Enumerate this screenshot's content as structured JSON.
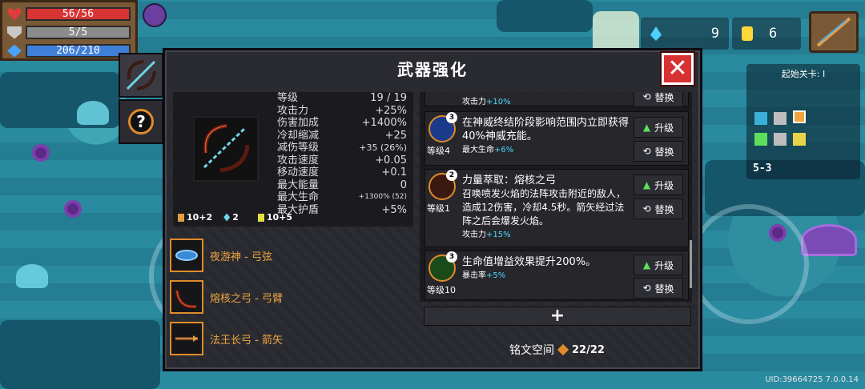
{
  "hud": {
    "hp": "56/56",
    "armor": "5/5",
    "energy": "206/210",
    "blue_currency": "9",
    "gold_currency": "6"
  },
  "minimap": {
    "title": "起始关卡: I",
    "level": "5-3"
  },
  "uid": "UID:39664725 7.0.0.14",
  "dialog": {
    "title": "武器强化",
    "close_label": "✕"
  },
  "weapon_stats": [
    {
      "label": "等级",
      "value": "19 / 19"
    },
    {
      "label": "攻击力",
      "value": "+25%"
    },
    {
      "label": "伤害加成",
      "value": "+1400%"
    },
    {
      "label": "冷却缩减",
      "value": "+25"
    },
    {
      "label": "减伤等级",
      "value": "+35 (26%)"
    },
    {
      "label": "攻击速度",
      "value": "+0.05"
    },
    {
      "label": "移动速度",
      "value": "+0.1"
    },
    {
      "label": "最大能量",
      "value": "0"
    },
    {
      "label": "最大生命",
      "value": "+1300% (52)"
    },
    {
      "label": "最大护盾",
      "value": "+5%"
    }
  ],
  "weapon_footer": {
    "atk": "10+2",
    "crystal": "2",
    "crit": "10+5"
  },
  "parts": [
    {
      "name": "夜游神 - 弓弦"
    },
    {
      "name": "熔核之弓 - 弓臂"
    },
    {
      "name": "法王长弓 - 箭矢"
    }
  ],
  "inscriptions": {
    "partial_top": {
      "sub_prefix": "攻击力",
      "sub_value": "+10%",
      "swap": "替换"
    },
    "items": [
      {
        "desc": "在神威终结阶段影响范围内立即获得40%神威充能。",
        "sub_prefix": "最大生命",
        "sub_value": "+6%",
        "level": "等级4",
        "badge": "3",
        "upgrade": "升级",
        "swap": "替换"
      },
      {
        "desc": "力量萃取：熔核之弓",
        "desc2": "召唤喷发火焰的法阵攻击附近的敌人，造成12伤害，冷却4.5秒。箭矢经过法阵之后会爆发火焰。",
        "sub_prefix": "攻击力",
        "sub_value": "+15%",
        "level": "等级1",
        "badge": "2",
        "upgrade": "升级",
        "swap": "替换"
      },
      {
        "desc": "生命值增益效果提升200%。",
        "sub_prefix": "暴击率",
        "sub_value": "+5%",
        "level": "等级10",
        "badge": "3",
        "upgrade": "升级",
        "swap": "替换"
      }
    ]
  },
  "add_label": "+",
  "slots": {
    "label": "铭文空间",
    "count": "22/22"
  },
  "colors": {
    "accent_orange": "#e08b2b",
    "close_red": "#d83131",
    "highlight_blue": "#4bd9ff",
    "upgrade_green": "#5ce05c"
  }
}
